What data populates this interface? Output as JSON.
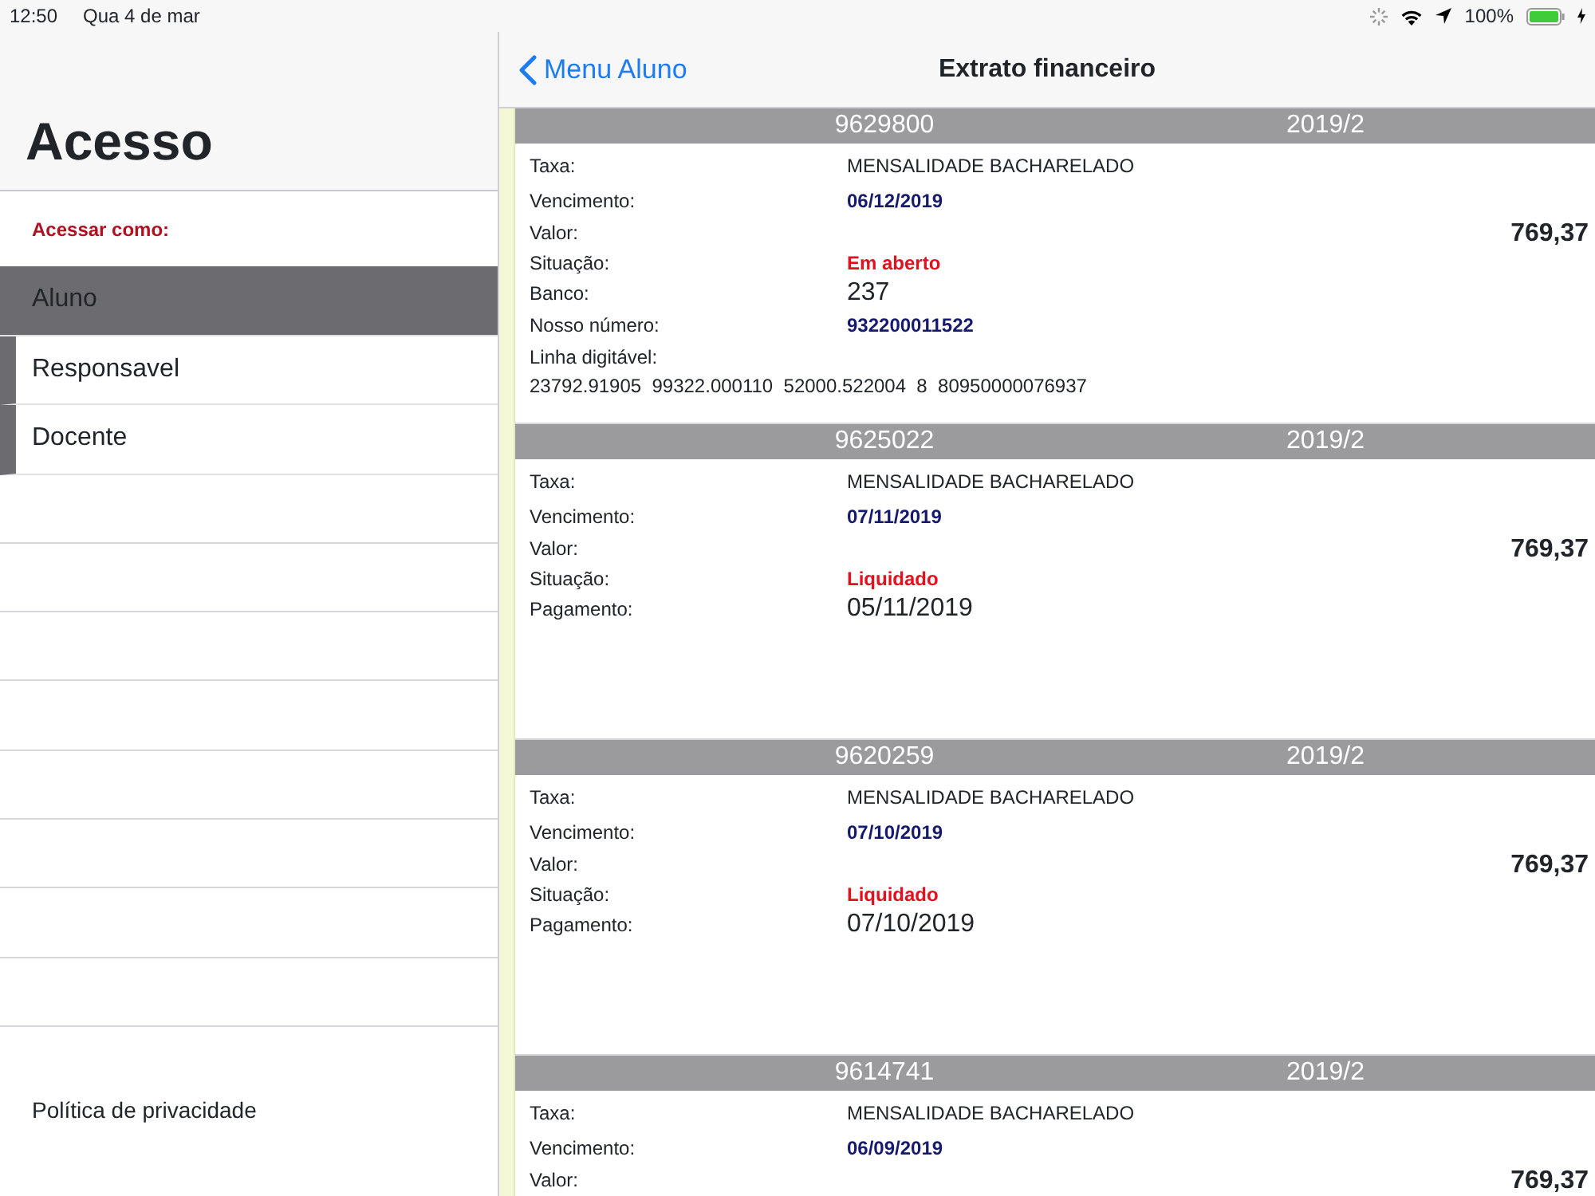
{
  "status_bar": {
    "time": "12:50",
    "date": "Qua 4 de mar",
    "battery": "100%"
  },
  "sidebar": {
    "title": "Acesso",
    "section": "Acessar como:",
    "items": [
      {
        "label": "Aluno",
        "selected": true
      },
      {
        "label": "Responsavel",
        "selected": false
      },
      {
        "label": "Docente",
        "selected": false
      }
    ],
    "footer_link": "Política de privacidade"
  },
  "nav": {
    "back": "Menu Aluno",
    "title": "Extrato financeiro"
  },
  "cards": [
    {
      "number": "9629800",
      "period": "2019/2",
      "rows": [
        {
          "label": "Taxa:",
          "value": "MENSALIDADE BACHARELADO",
          "kind": "plain"
        },
        {
          "label": "Vencimento:",
          "value": "06/12/2019",
          "kind": "date"
        },
        {
          "label": "Valor:",
          "value": "769,37",
          "kind": "amount"
        },
        {
          "label": "Situação:",
          "value": "Em aberto",
          "kind": "status"
        },
        {
          "label": "Banco:",
          "value": "237",
          "kind": "large"
        },
        {
          "label": "Nosso número:",
          "value": "932200011522",
          "kind": "date"
        },
        {
          "label": "Linha digitável:",
          "value": "23792.91905  99322.000110  52000.522004  8  80950000076937",
          "kind": "line"
        }
      ]
    },
    {
      "number": "9625022",
      "period": "2019/2",
      "rows": [
        {
          "label": "Taxa:",
          "value": "MENSALIDADE BACHARELADO",
          "kind": "plain"
        },
        {
          "label": "Vencimento:",
          "value": "07/11/2019",
          "kind": "date"
        },
        {
          "label": "Valor:",
          "value": "769,37",
          "kind": "amount"
        },
        {
          "label": "Situação:",
          "value": "Liquidado",
          "kind": "status"
        },
        {
          "label": "Pagamento:",
          "value": "05/11/2019",
          "kind": "large"
        }
      ]
    },
    {
      "number": "9620259",
      "period": "2019/2",
      "rows": [
        {
          "label": "Taxa:",
          "value": "MENSALIDADE BACHARELADO",
          "kind": "plain"
        },
        {
          "label": "Vencimento:",
          "value": "07/10/2019",
          "kind": "date"
        },
        {
          "label": "Valor:",
          "value": "769,37",
          "kind": "amount"
        },
        {
          "label": "Situação:",
          "value": "Liquidado",
          "kind": "status"
        },
        {
          "label": "Pagamento:",
          "value": "07/10/2019",
          "kind": "large"
        }
      ]
    },
    {
      "number": "9614741",
      "period": "2019/2",
      "rows": [
        {
          "label": "Taxa:",
          "value": "MENSALIDADE BACHARELADO",
          "kind": "plain"
        },
        {
          "label": "Vencimento:",
          "value": "06/09/2019",
          "kind": "date"
        },
        {
          "label": "Valor:",
          "value": "769,37",
          "kind": "amount"
        }
      ]
    }
  ]
}
